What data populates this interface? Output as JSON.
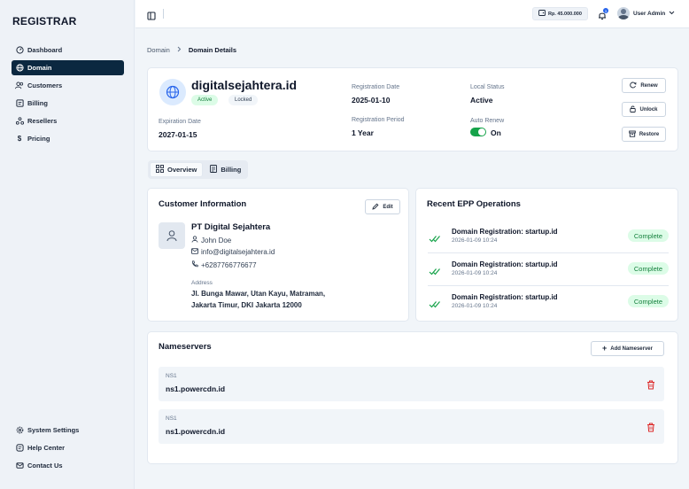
{
  "app": {
    "brand": "REGISTRAR"
  },
  "sidebar": {
    "items": [
      {
        "label": "Dashboard",
        "icon": "dashboard-icon"
      },
      {
        "label": "Domain",
        "icon": "globe-icon",
        "active": true
      },
      {
        "label": "Customers",
        "icon": "users-icon"
      },
      {
        "label": "Billing",
        "icon": "billing-icon"
      },
      {
        "label": "Resellers",
        "icon": "resellers-icon"
      },
      {
        "label": "Pricing",
        "icon": "dollar-icon"
      }
    ],
    "bottom_items": [
      {
        "label": "System Settings",
        "icon": "gear-icon"
      },
      {
        "label": "Help Center",
        "icon": "help-icon"
      },
      {
        "label": "Contact Us",
        "icon": "mail-icon"
      }
    ]
  },
  "topbar": {
    "balance": "Rp. 45.000.000",
    "notifications_count": "3",
    "user_name": "User Admin"
  },
  "breadcrumb": {
    "parent": "Domain",
    "current": "Domain Details"
  },
  "domain": {
    "name": "digitalsejahtera.id",
    "badges": {
      "active": "Active",
      "locked": "Locked"
    },
    "registration_date_label": "Registration Date",
    "registration_date": "2025-01-10",
    "local_status_label": "Local Status",
    "local_status": "Active",
    "expiration_date_label": "Expiration Date",
    "expiration_date": "2027-01-15",
    "registration_period_label": "Registration Period",
    "registration_period": "1 Year",
    "auto_renew_label": "Auto Renew",
    "auto_renew": "On",
    "actions": {
      "renew": "Renew",
      "unlock": "Unlock",
      "restore": "Restore"
    }
  },
  "tabs": {
    "overview": "Overview",
    "billing": "Billing"
  },
  "customer": {
    "title": "Customer Information",
    "edit_label": "Edit",
    "company": "PT Digital Sejahtera",
    "contact_name": "John Doe",
    "email": "info@digitalsejahtera.id",
    "phone": "+6287766776677",
    "address_label": "Address",
    "address_line1": "Jl. Bunga Mawar, Utan Kayu, Matraman,",
    "address_line2": "Jakarta Timur, DKI Jakarta 12000"
  },
  "epp": {
    "title": "Recent EPP Operations",
    "operations": [
      {
        "title": "Domain Registration: startup.id",
        "time": "2026-01-09 10:24",
        "status": "Complete"
      },
      {
        "title": "Domain Registration: startup.id",
        "time": "2026-01-09 10:24",
        "status": "Complete"
      },
      {
        "title": "Domain Registration: startup.id",
        "time": "2026-01-09 10:24",
        "status": "Complete"
      }
    ]
  },
  "nameservers": {
    "title": "Nameservers",
    "add_label": "Add Nameserver",
    "items": [
      {
        "label": "NS1",
        "value": "ns1.powercdn.id"
      },
      {
        "label": "NS1",
        "value": "ns1.powercdn.id"
      }
    ]
  },
  "colors": {
    "sidebar_active": "#0b2840",
    "success": "#16a34a",
    "danger": "#dc2626"
  }
}
